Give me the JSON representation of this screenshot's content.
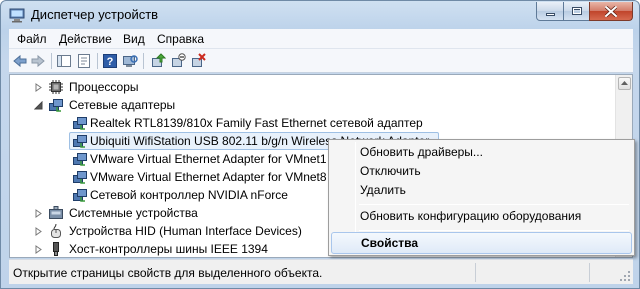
{
  "window": {
    "title": "Диспетчер устройств"
  },
  "menu": {
    "file": "Файл",
    "action": "Действие",
    "view": "Вид",
    "help": "Справка"
  },
  "toolbar": {
    "icons": [
      "back-arrow-icon",
      "forward-arrow-icon",
      "show-hide-tree-icon",
      "properties-icon",
      "help-icon",
      "scan-hardware-icon",
      "update-driver-icon",
      "disable-device-icon",
      "uninstall-device-icon"
    ]
  },
  "tree": {
    "items": [
      {
        "label": "Процессоры",
        "icon": "processor-icon",
        "expander": "collapsed"
      },
      {
        "label": "Сетевые адаптеры",
        "icon": "network-adapter-category-icon",
        "expander": "expanded"
      },
      {
        "label": "Realtek RTL8139/810x Family Fast Ethernet сетевой адаптер",
        "icon": "network-adapter-icon"
      },
      {
        "label": "Ubiquiti WifiStation USB 802.11 b/g/n Wireless Network Adapter",
        "icon": "network-adapter-icon",
        "selected": true
      },
      {
        "label": "VMware Virtual Ethernet Adapter for VMnet1",
        "icon": "network-adapter-icon"
      },
      {
        "label": "VMware Virtual Ethernet Adapter for VMnet8",
        "icon": "network-adapter-icon"
      },
      {
        "label": "Сетевой контроллер NVIDIA nForce",
        "icon": "network-adapter-icon"
      },
      {
        "label": "Системные устройства",
        "icon": "system-devices-icon",
        "expander": "collapsed"
      },
      {
        "label": "Устройства HID (Human Interface Devices)",
        "icon": "hid-icon",
        "expander": "collapsed"
      },
      {
        "label": "Хост-контроллеры шины IEEE 1394",
        "icon": "ieee1394-icon",
        "expander": "collapsed"
      }
    ]
  },
  "context_menu": {
    "update_drivers": "Обновить драйверы...",
    "disable": "Отключить",
    "uninstall": "Удалить",
    "scan_hardware": "Обновить конфигурацию оборудования",
    "properties": "Свойства"
  },
  "status": {
    "text": "Открытие страницы свойств для выделенного объекта."
  },
  "colors": {
    "selection": "#e8f1fb",
    "title_bar": "#bcd2ea",
    "close_button": "#c0442b"
  }
}
